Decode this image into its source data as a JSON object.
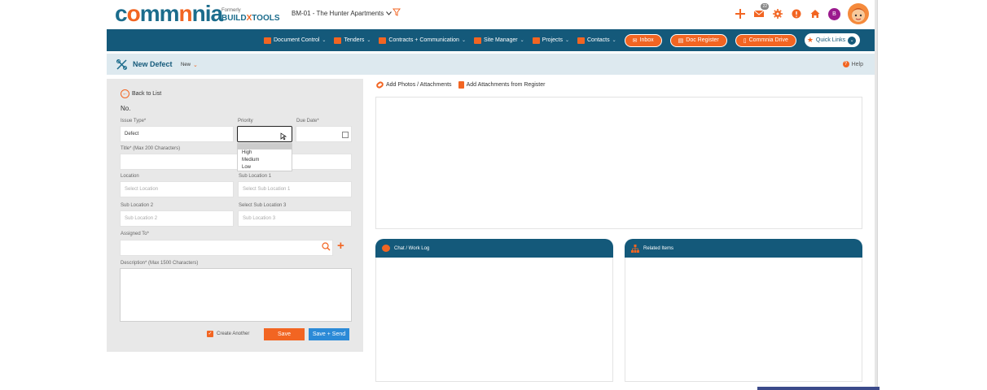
{
  "brand": {
    "logo_pre": "c",
    "logo_o1": "o",
    "logo_mid": "mm",
    "logo_rest": "nia",
    "formerly": "Formerly",
    "bt_build": "BUILD",
    "bt_x": "X",
    "bt_tools": "TOOLS"
  },
  "header": {
    "project": "BM-01 - The Hunter Apartments",
    "mail_count": "22",
    "user_initial": "B"
  },
  "nav": {
    "items": [
      {
        "label": "Document Control"
      },
      {
        "label": "Tenders"
      },
      {
        "label": "Contracts + Communication"
      },
      {
        "label": "Site Manager"
      },
      {
        "label": "Projects"
      },
      {
        "label": "Contacts"
      }
    ],
    "buttons": [
      {
        "label": "Inbox"
      },
      {
        "label": "Doc Register"
      },
      {
        "label": "Commnia Drive"
      }
    ],
    "quick_links": "Quick Links"
  },
  "page": {
    "title": "New Defect",
    "status": "New",
    "help": "Help"
  },
  "form": {
    "back": "Back to List",
    "no_label": "No.",
    "issue_type": {
      "label": "Issue Type*",
      "value": "Defect"
    },
    "priority": {
      "label": "Priority",
      "value": "",
      "options": [
        "High",
        "Medium",
        "Low"
      ]
    },
    "due_date": {
      "label": "Due Date*",
      "value": ""
    },
    "title": {
      "label": "Title* (Max 200 Characters)",
      "value": ""
    },
    "location": {
      "label": "Location",
      "placeholder": "Select Location"
    },
    "sub_location_1": {
      "label": "Sub Location 1",
      "placeholder": "Select Sub Location 1"
    },
    "sub_location_2": {
      "label": "Sub Location 2",
      "placeholder": "Sub Location 2"
    },
    "sub_location_3": {
      "label": "Select Sub Location 3",
      "placeholder": "Sub Location 3"
    },
    "assigned_to": {
      "label": "Assigned To*",
      "value": ""
    },
    "description": {
      "label": "Description* (Max 1500 Characters)"
    },
    "create_another": "Create Another",
    "save": "Save",
    "save_send": "Save + Send"
  },
  "attachments": {
    "add_photos": "Add Photos / Attachments",
    "add_from_register": "Add Attachments from Register"
  },
  "panels": {
    "chat": "Chat / Work Log",
    "related": "Related Items"
  }
}
